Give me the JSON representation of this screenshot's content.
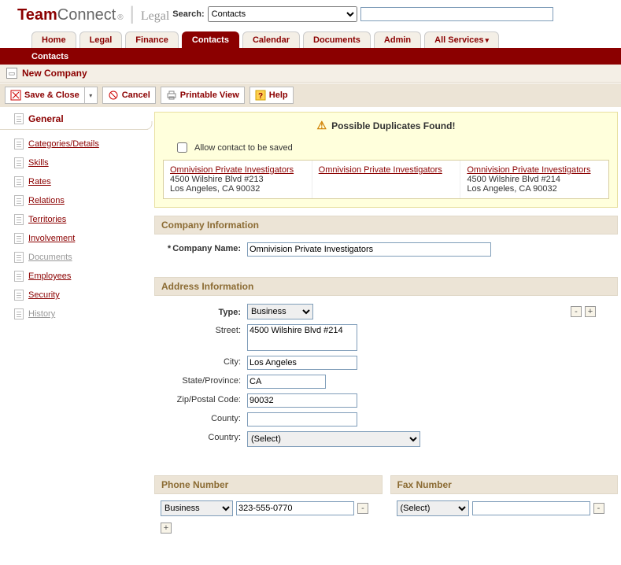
{
  "header": {
    "logo_team": "Team",
    "logo_connect": "Connect",
    "logo_legal": "Legal",
    "search_label": "Search:",
    "search_dropdown": "Contacts",
    "search_value": ""
  },
  "tabs": {
    "items": [
      "Home",
      "Legal",
      "Finance",
      "Contacts",
      "Calendar",
      "Documents",
      "Admin",
      "All Services"
    ],
    "active_index": 3
  },
  "subbar": {
    "text": "Contacts"
  },
  "page": {
    "title": "New Company"
  },
  "toolbar": {
    "save_close": "Save & Close",
    "cancel": "Cancel",
    "printable": "Printable View",
    "help": "Help"
  },
  "sidebar": {
    "heading": "General",
    "items": [
      {
        "label": "Categories/Details",
        "enabled": true
      },
      {
        "label": "Skills",
        "enabled": true
      },
      {
        "label": "Rates",
        "enabled": true
      },
      {
        "label": "Relations",
        "enabled": true
      },
      {
        "label": "Territories",
        "enabled": true
      },
      {
        "label": "Involvement",
        "enabled": true
      },
      {
        "label": "Documents",
        "enabled": false
      },
      {
        "label": "Employees",
        "enabled": true
      },
      {
        "label": "Security",
        "enabled": true
      },
      {
        "label": "History",
        "enabled": false
      }
    ]
  },
  "duplicates": {
    "title": "Possible Duplicates Found!",
    "allow_label": "Allow contact to be saved",
    "entries": [
      {
        "name": "Omnivision Private Investigators",
        "addr1": "4500 Wilshire Blvd #213",
        "addr2": "Los Angeles, CA 90032"
      },
      {
        "name": "Omnivision Private Investigators",
        "addr1": "",
        "addr2": ""
      },
      {
        "name": "Omnivision Private Investigators",
        "addr1": "4500 Wilshire Blvd #214",
        "addr2": "Los Angeles, CA 90032"
      }
    ]
  },
  "company": {
    "section_title": "Company Information",
    "name_label": "Company Name:",
    "name_value": "Omnivision Private Investigators"
  },
  "address": {
    "section_title": "Address Information",
    "type_label": "Type:",
    "type_value": "Business",
    "street_label": "Street:",
    "street_value": "4500 Wilshire Blvd #214",
    "city_label": "City:",
    "city_value": "Los Angeles",
    "state_label": "State/Province:",
    "state_value": "CA",
    "zip_label": "Zip/Postal Code:",
    "zip_value": "90032",
    "county_label": "County:",
    "county_value": "",
    "country_label": "Country:",
    "country_value": "(Select)"
  },
  "phone": {
    "section_title": "Phone Number",
    "type_value": "Business",
    "number_value": "323-555-0770"
  },
  "fax": {
    "section_title": "Fax Number",
    "type_value": "(Select)",
    "number_value": ""
  },
  "icons": {
    "minus": "-",
    "plus": "+",
    "chevron_down": "▾"
  }
}
